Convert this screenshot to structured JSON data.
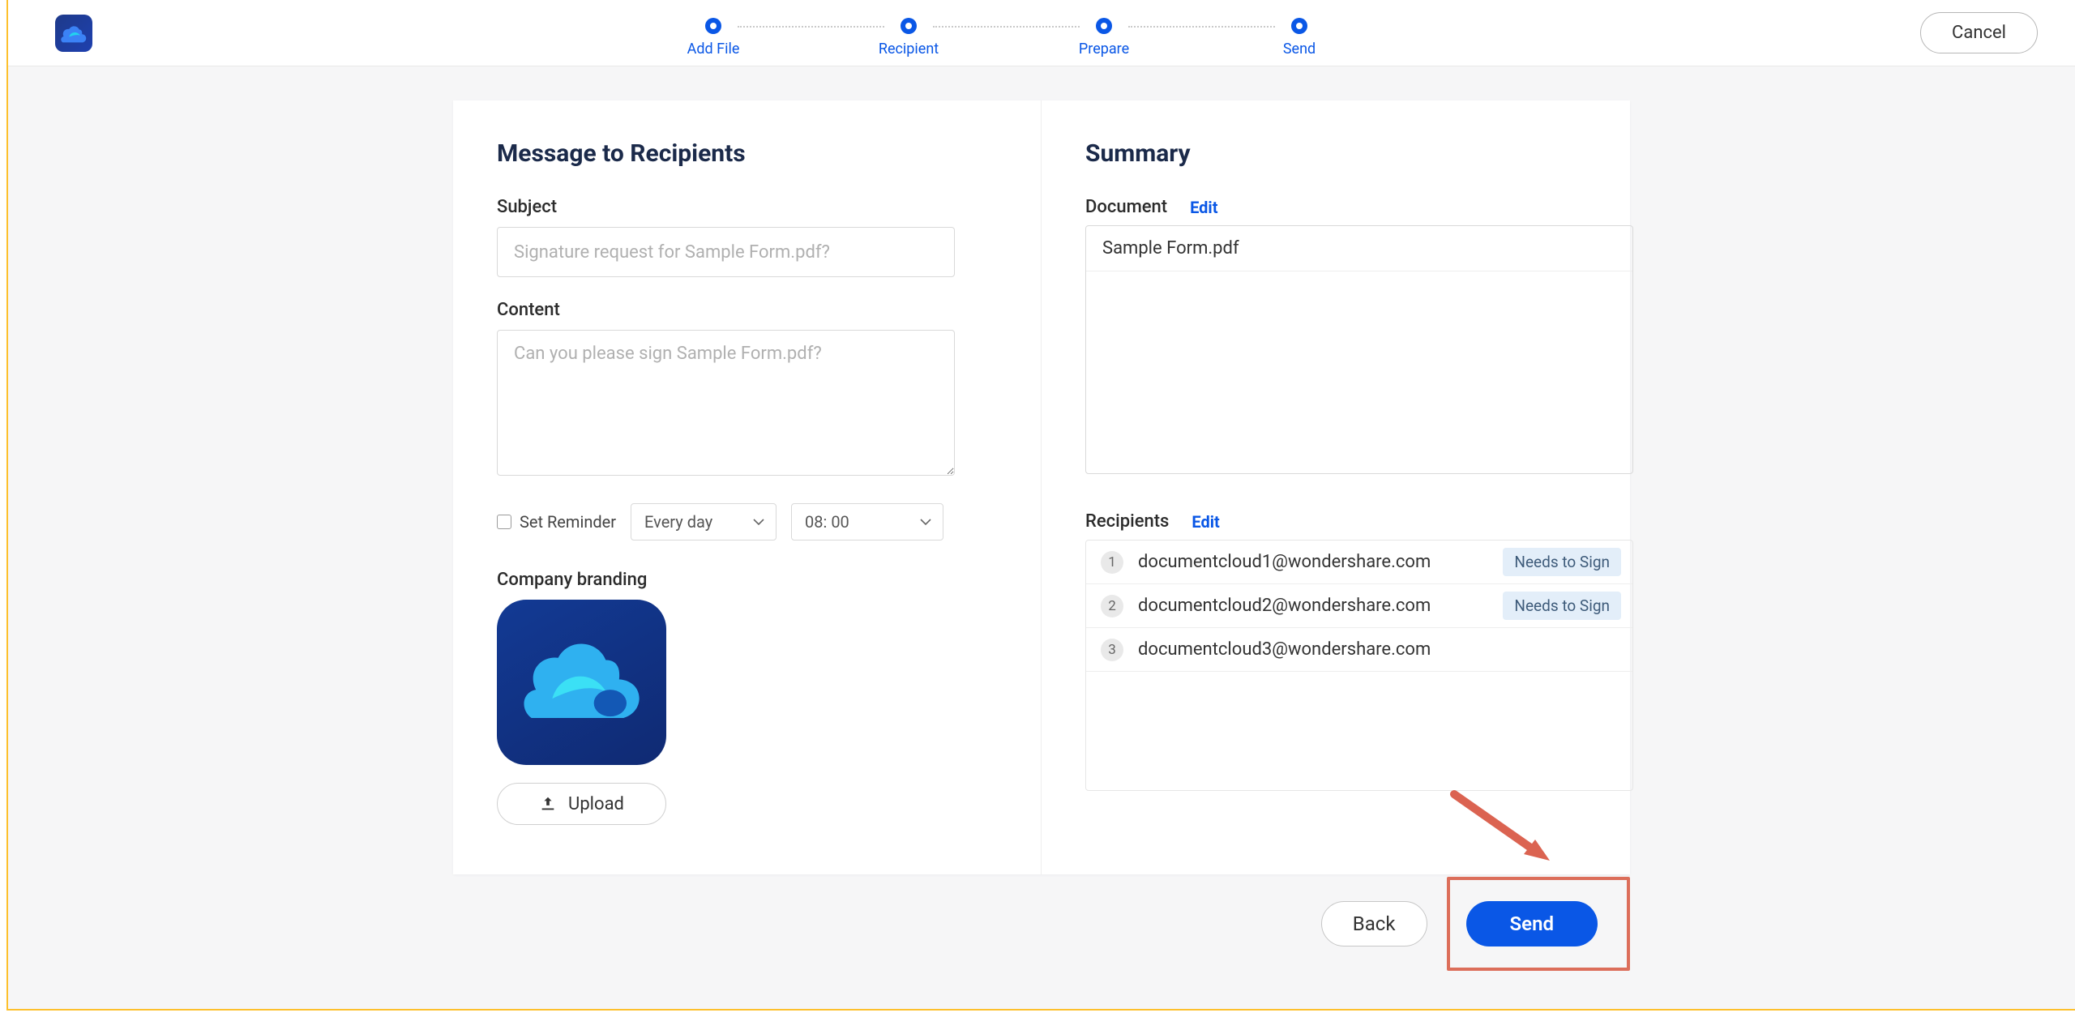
{
  "header": {
    "cancel_label": "Cancel",
    "steps": [
      "Add File",
      "Recipient",
      "Prepare",
      "Send"
    ]
  },
  "left": {
    "title": "Message to Recipients",
    "subject_label": "Subject",
    "subject_placeholder": "Signature request for Sample Form.pdf?",
    "content_label": "Content",
    "content_placeholder": "Can you please sign Sample Form.pdf?",
    "reminder_label": "Set Reminder",
    "reminder_freq": "Every day",
    "reminder_time": "08: 00",
    "branding_label": "Company branding",
    "upload_label": "Upload"
  },
  "right": {
    "title": "Summary",
    "document_label": "Document",
    "edit_label": "Edit",
    "document_name": "Sample Form.pdf",
    "recipients_label": "Recipients",
    "recipients": [
      {
        "n": "1",
        "email": "documentcloud1@wondershare.com",
        "status": "Needs to Sign"
      },
      {
        "n": "2",
        "email": "documentcloud2@wondershare.com",
        "status": "Needs to Sign"
      },
      {
        "n": "3",
        "email": "documentcloud3@wondershare.com",
        "status": ""
      }
    ]
  },
  "footer": {
    "back_label": "Back",
    "send_label": "Send"
  }
}
